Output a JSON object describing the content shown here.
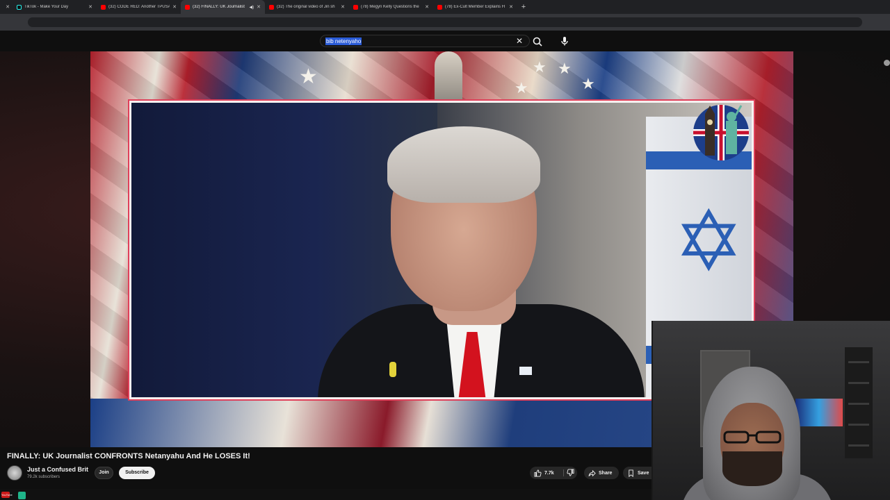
{
  "browser": {
    "tabs": [
      {
        "title": "",
        "favicon": "none",
        "active": false
      },
      {
        "title": "TikTok - Make Your Day",
        "favicon": "tiktok-icon",
        "active": false
      },
      {
        "title": "(32) CODE RED: Another TPUSA",
        "favicon": "youtube-icon",
        "active": false
      },
      {
        "title": "(32) FINALLY: UK Journalist",
        "favicon": "youtube-icon",
        "active": true,
        "audio": true
      },
      {
        "title": "(32) The original video of Jin sh",
        "favicon": "youtube-icon",
        "active": false
      },
      {
        "title": "(78) Megyn Kelly Questions the",
        "favicon": "youtube-icon",
        "active": false
      },
      {
        "title": "(78) Ex-Cult Member Explains H",
        "favicon": "youtube-icon",
        "active": false
      }
    ],
    "close_glyph": "✕",
    "new_tab_glyph": "+"
  },
  "search": {
    "query": "bib netenyaho",
    "clear_glyph": "✕"
  },
  "video": {
    "title": "FINALLY: UK Journalist CONFRONTS Netanyahu And He LOSES It!",
    "channel": {
      "name": "Just a Confused Brit",
      "subscribers": "79.2k subscribers"
    },
    "join_label": "Join",
    "subscribe_label": "Subscribe",
    "likes": "7.7k",
    "share_label": "Share",
    "save_label": "Save"
  },
  "taskbar": {
    "yt_label": "YouTube"
  },
  "colors": {
    "accent": "#ff0000",
    "highlight": "#2a5bd7",
    "frame_border": "#e0405a"
  }
}
